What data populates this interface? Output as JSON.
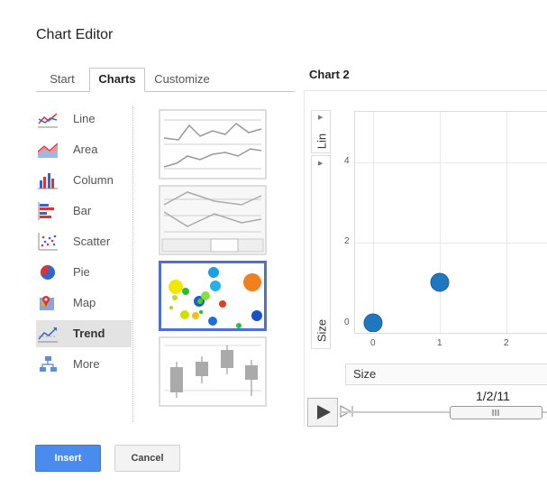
{
  "dialog": {
    "title": "Chart Editor"
  },
  "tabs": [
    {
      "label": "Start"
    },
    {
      "label": "Charts"
    },
    {
      "label": "Customize"
    }
  ],
  "chart_types": [
    {
      "label": "Line",
      "icon": "line-chart-icon"
    },
    {
      "label": "Area",
      "icon": "area-chart-icon"
    },
    {
      "label": "Column",
      "icon": "column-chart-icon"
    },
    {
      "label": "Bar",
      "icon": "bar-chart-icon"
    },
    {
      "label": "Scatter",
      "icon": "scatter-chart-icon"
    },
    {
      "label": "Pie",
      "icon": "pie-chart-icon"
    },
    {
      "label": "Map",
      "icon": "map-chart-icon"
    },
    {
      "label": "Trend",
      "icon": "trend-chart-icon",
      "selected": true
    },
    {
      "label": "More",
      "icon": "more-charts-icon"
    }
  ],
  "preview": {
    "title": "Chart 2",
    "y_axis_control": "Lin",
    "size_axis_label": "Size",
    "y_ticks": [
      "4",
      "2",
      "0"
    ],
    "x_ticks": [
      "0",
      "1",
      "2"
    ],
    "size_dropdown": "Size",
    "date_label": "1/2/11"
  },
  "buttons": {
    "insert": "Insert",
    "cancel": "Cancel"
  },
  "colors": {
    "accent": "#4a8bee",
    "bubble": "#1f77c0",
    "selection": "#4d70d4"
  }
}
